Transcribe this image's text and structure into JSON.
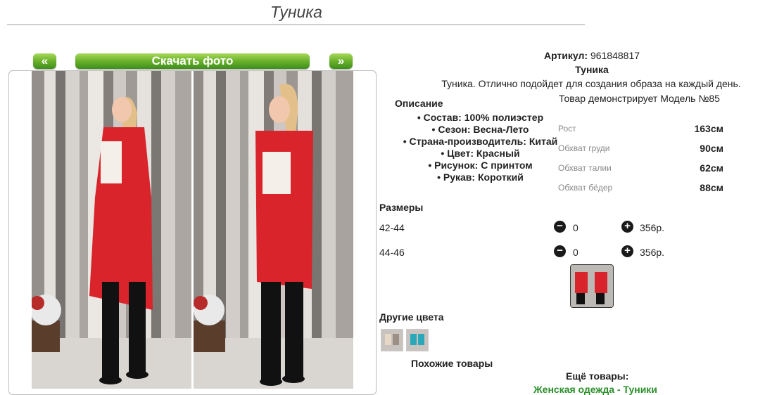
{
  "page": {
    "title": "Туника"
  },
  "gallery": {
    "prev_label": "«",
    "download_label": "Скачать фото",
    "next_label": "»"
  },
  "product": {
    "article_label": "Артикул:",
    "article_value": "961848817",
    "name": "Туника",
    "tagline": "Туника. Отлично подойдет для создания образа на каждый день.",
    "model_note": "Товар демонстрирует Модель №85"
  },
  "description": {
    "heading": "Описание",
    "items": [
      "Состав: 100% полиэстер",
      "Сезон: Весна-Лето",
      "Страна-производитель: Китай",
      "Цвет: Красный",
      "Рисунок: С принтом",
      "Рукав: Короткий"
    ]
  },
  "measurements": [
    {
      "label": "Рост",
      "value": "163см"
    },
    {
      "label": "Обхват груди",
      "value": "90см"
    },
    {
      "label": "Обхват талии",
      "value": "62см"
    },
    {
      "label": "Обхват бёдер",
      "value": "88см"
    }
  ],
  "sizes": {
    "heading": "Размеры",
    "rows": [
      {
        "size": "42-44",
        "qty": "0",
        "price": "356р."
      },
      {
        "size": "44-46",
        "qty": "0",
        "price": "356р."
      }
    ]
  },
  "other_colors": {
    "heading": "Другие цвета"
  },
  "similar": {
    "heading": "Похожие товары"
  },
  "more": {
    "heading": "Ещё товары:",
    "link_text": "Женская одежда - Туники"
  },
  "colors": {
    "accent_green": "#6ab12b",
    "product_red": "#d9242c"
  },
  "icons": {
    "minus": "minus-circle-icon",
    "plus": "plus-circle-icon"
  }
}
